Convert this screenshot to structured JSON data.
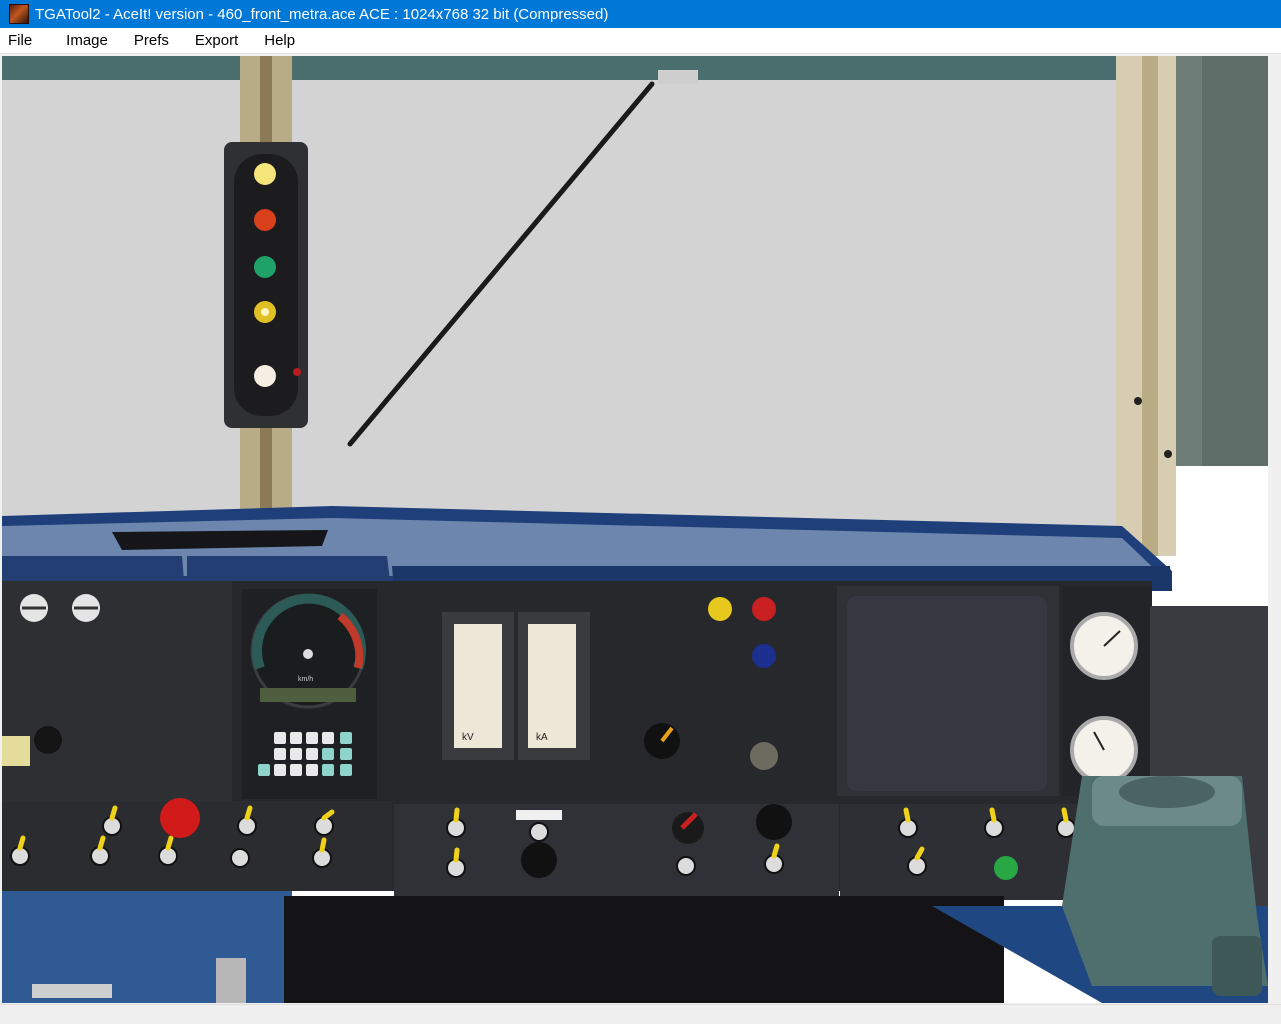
{
  "window": {
    "title": "TGATool2 - AceIt! version - 460_front_metra.ace   ACE : 1024x768 32 bit (Compressed)"
  },
  "menu": {
    "items": [
      "File",
      "Image",
      "Prefs",
      "Export",
      "Help"
    ]
  },
  "image": {
    "description_icon": "locomotive-cab-texture",
    "panel_labels": {
      "speed_unit": "km/h",
      "kv_gauge": "kV",
      "ka_gauge": "kA"
    }
  },
  "colors": {
    "titlebar": "#0078d7",
    "window_glass": "#d3d3d3",
    "dashboard_blue": "#1f3f7a",
    "console_dark": "#27282b"
  }
}
